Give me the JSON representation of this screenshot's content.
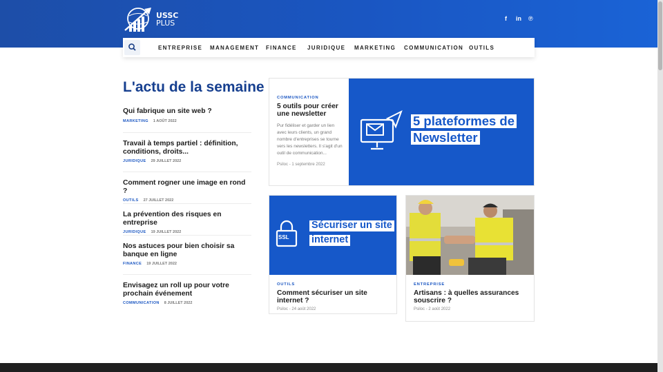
{
  "brand": {
    "line1": "USSC",
    "line2": "PLUS"
  },
  "social": [
    {
      "name": "facebook-icon",
      "glyph": "f"
    },
    {
      "name": "linkedin-icon",
      "glyph": "in"
    },
    {
      "name": "pinterest-icon",
      "glyph": "℗"
    }
  ],
  "nav": {
    "items": [
      "ENTREPRISE",
      "MANAGEMENT",
      "FINANCE",
      "JURIDIQUE",
      "MARKETING",
      "COMMUNICATION",
      "OUTILS"
    ]
  },
  "week": {
    "heading": "L'actu de la semaine",
    "posts": [
      {
        "title": "Qui fabrique un site web ?",
        "category": "MARKETING",
        "date": "1 AOÛT 2022"
      },
      {
        "title": "Travail à temps partiel : définition, conditions, droits...",
        "category": "JURIDIQUE",
        "date": "29 JUILLET 2022"
      },
      {
        "title": "Comment rogner une image en rond ?",
        "category": "OUTILS",
        "date": "27 JUILLET 2022"
      },
      {
        "title": "La prévention des risques en entreprise",
        "category": "JURIDIQUE",
        "date": "19 JUILLET 2022"
      },
      {
        "title": "Nos astuces pour bien choisir sa banque en ligne",
        "category": "FINANCE",
        "date": "19 JUILLET 2022"
      },
      {
        "title": "Envisagez un roll up pour votre prochain événement",
        "category": "COMMUNICATION",
        "date": "8 JUILLET 2022"
      }
    ]
  },
  "featured": {
    "category": "COMMUNICATION",
    "title": "5 outils pour créer une newsletter",
    "excerpt": "Pur fidéliser et garder un lien avec leurs clients, un grand nombre d'entreprises se tourne vers les newsletters. Il s'agit d'un outil de communication...",
    "author": "Psiloc",
    "date": "1 septembre 2022",
    "image_text": {
      "line1": "5 plateformes de",
      "line2": "Newsletter"
    }
  },
  "card_security": {
    "category": "OUTILS",
    "title": "Comment sécuriser un site internet ?",
    "author": "Psiloc",
    "date": "24 août 2022",
    "image_text": {
      "line1": "Sécuriser un site",
      "line2": "internet",
      "badge": "SSL"
    }
  },
  "card_artisans": {
    "category": "ENTREPRISE",
    "title": "Artisans : à quelles assurances souscrire ?",
    "author": "Psiloc",
    "date": "2 août 2022"
  },
  "meta_sep": "-",
  "colors": {
    "brand_blue": "#1658c9",
    "heading_blue": "#163f8f",
    "header_blue": "#1a56c2"
  }
}
